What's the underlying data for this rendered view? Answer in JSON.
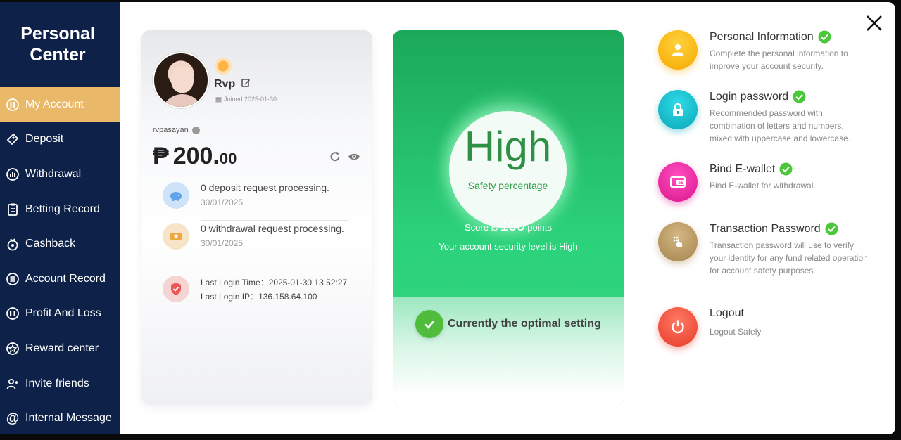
{
  "sidebar": {
    "title_line1": "Personal",
    "title_line2": "Center",
    "items": [
      {
        "label": "My Account",
        "icon": "account-icon",
        "active": true
      },
      {
        "label": "Deposit",
        "icon": "deposit-icon"
      },
      {
        "label": "Withdrawal",
        "icon": "withdrawal-icon"
      },
      {
        "label": "Betting Record",
        "icon": "betting-record-icon"
      },
      {
        "label": "Cashback",
        "icon": "cashback-icon"
      },
      {
        "label": "Account Record",
        "icon": "account-record-icon"
      },
      {
        "label": "Profit And Loss",
        "icon": "profit-loss-icon"
      },
      {
        "label": "Reward center",
        "icon": "reward-icon"
      },
      {
        "label": "Invite friends",
        "icon": "invite-icon"
      },
      {
        "label": "Internal Message",
        "icon": "message-icon"
      }
    ]
  },
  "account": {
    "username": "Rvp",
    "joined": "Joined 2025-01-30",
    "account_name": "rvpasayan",
    "balance_currency": "₱",
    "balance_main": "200.",
    "balance_decimal": "00",
    "deposit_status": "0 deposit request processing.",
    "deposit_date": "30/01/2025",
    "withdrawal_status": "0 withdrawal request processing.",
    "withdrawal_date": "30/01/2025",
    "last_login_time_label": "Last Login Time：",
    "last_login_time": "2025-01-30 13:52:27",
    "last_login_ip_label": "Last Login IP：",
    "last_login_ip": "136.158.64.100"
  },
  "security": {
    "level": "High",
    "percentage_label": "Safety percentage",
    "score_prefix": "Score is",
    "score_value": "100",
    "score_suffix": "points",
    "description": "Your account security level is High",
    "optimal_text": "Currently the optimal setting",
    "colors": {
      "primary": "#2cd17b",
      "text": "#2f8f43"
    }
  },
  "settings": [
    {
      "title": "Personal Information",
      "desc": "Complete the personal information to improve your account security.",
      "icon": "user-icon",
      "color": "#f7b500"
    },
    {
      "title": "Login password",
      "desc": "Recommended password with combination of letters and numbers, mixed with uppercase and lowercase.",
      "icon": "lock-icon",
      "color": "#14bccb"
    },
    {
      "title": "Bind E-wallet",
      "desc": "Bind E-wallet for withdrawal.",
      "icon": "wallet-icon",
      "color": "#e62c9b"
    },
    {
      "title": "Transaction Password",
      "desc": "Transaction password will use to verify your identity for any fund related operation for account safety purposes.",
      "icon": "keypad-icon",
      "color": "#b89860"
    },
    {
      "title": "Logout",
      "desc": "Logout Safely",
      "icon": "power-icon",
      "color": "#ee4d3a"
    }
  ]
}
